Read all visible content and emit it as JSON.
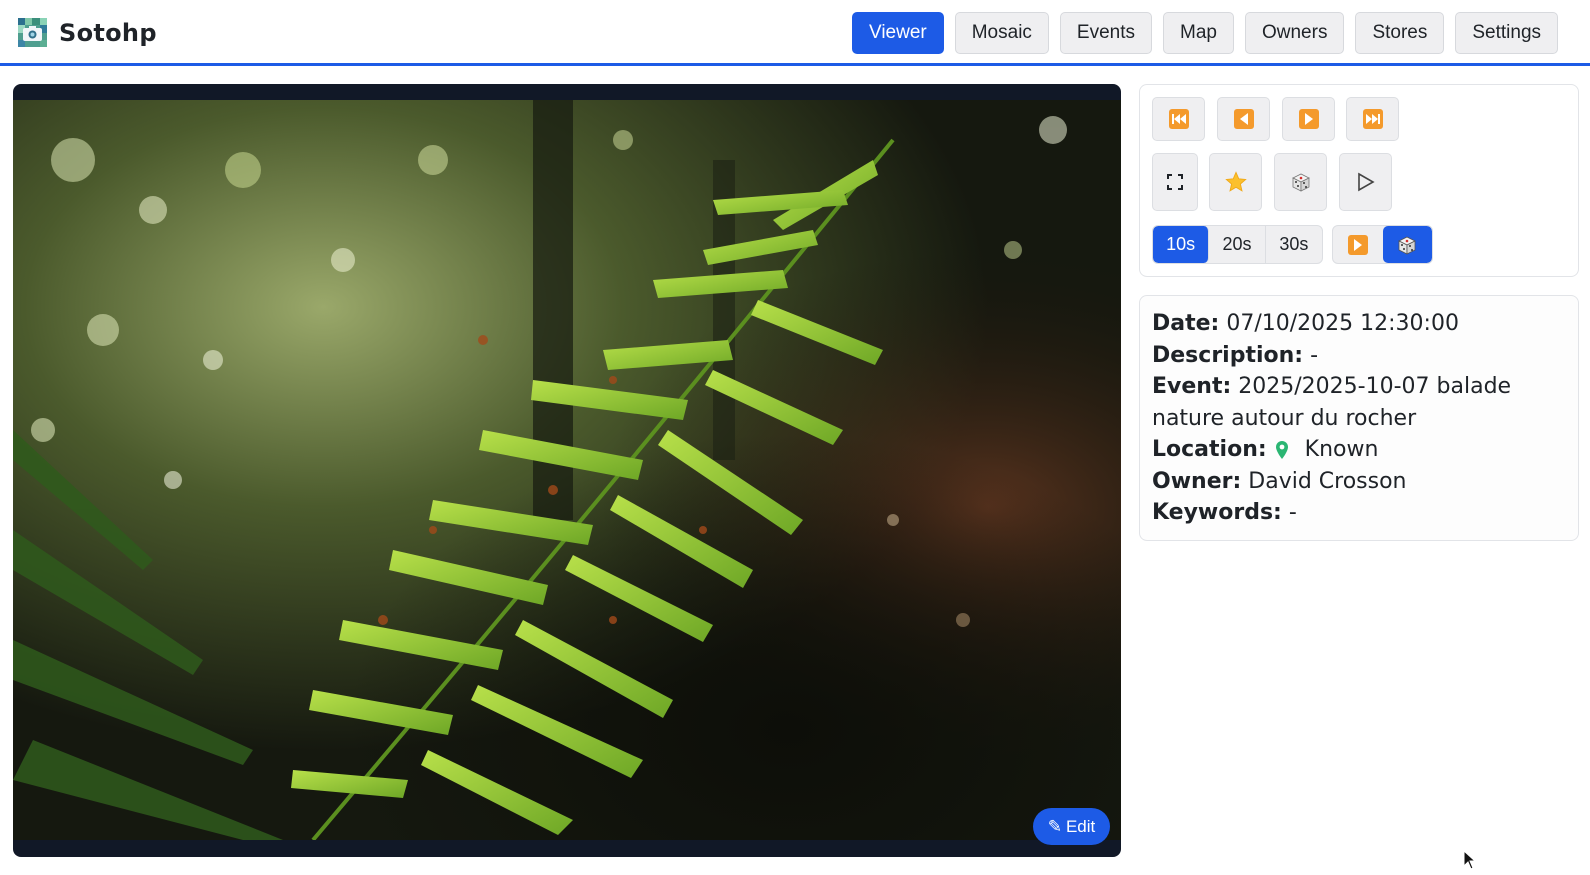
{
  "app": {
    "name": "Sotohp",
    "accent": "#1d5be6"
  },
  "nav": {
    "items": [
      {
        "label": "Viewer",
        "active": true
      },
      {
        "label": "Mosaic",
        "active": false
      },
      {
        "label": "Events",
        "active": false
      },
      {
        "label": "Map",
        "active": false
      },
      {
        "label": "Owners",
        "active": false
      },
      {
        "label": "Stores",
        "active": false
      },
      {
        "label": "Settings",
        "active": false
      }
    ]
  },
  "viewer": {
    "edit_label": "Edit",
    "edit_icon": "pencil-icon"
  },
  "controls": {
    "navigation": [
      "first-icon",
      "previous-icon",
      "next-icon",
      "last-icon"
    ],
    "actions": [
      "fullscreen-icon",
      "star-icon",
      "random-icon",
      "play-icon"
    ],
    "intervals": [
      {
        "label": "10s",
        "active": true
      },
      {
        "label": "20s",
        "active": false
      },
      {
        "label": "30s",
        "active": false
      }
    ],
    "modes": [
      {
        "icon": "sequential-play-icon",
        "active": false
      },
      {
        "icon": "random-dice-icon",
        "active": true
      }
    ]
  },
  "info": {
    "date_label": "Date:",
    "date_value": "07/10/2025 12:30:00",
    "description_label": "Description:",
    "description_value": "-",
    "event_label": "Event:",
    "event_value": "2025/2025-10-07 balade nature autour du rocher",
    "location_label": "Location:",
    "location_value": "Known",
    "owner_label": "Owner:",
    "owner_value": "David Crosson",
    "keywords_label": "Keywords:",
    "keywords_value": "-"
  }
}
